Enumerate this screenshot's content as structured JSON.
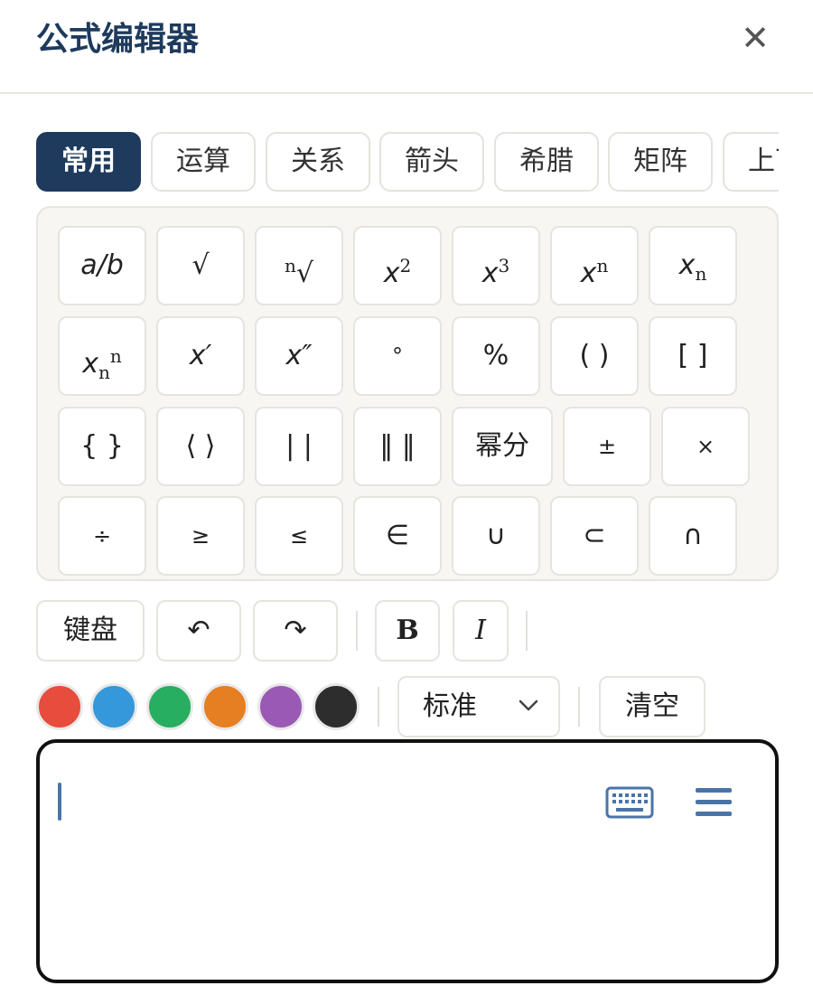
{
  "header": {
    "title": "公式编辑器",
    "close_glyph": "✕"
  },
  "tabs": [
    {
      "label": "常用",
      "active": true
    },
    {
      "label": "运算"
    },
    {
      "label": "关系"
    },
    {
      "label": "箭头"
    },
    {
      "label": "希腊"
    },
    {
      "label": "矩阵"
    },
    {
      "label": "上下"
    }
  ],
  "keys": {
    "fraction": "a/b",
    "sqrt": "√",
    "nroot_index": "n",
    "nroot_sign": "√",
    "sq_base": "x",
    "sq_exp": "2",
    "cube_base": "x",
    "cube_exp": "3",
    "pow_base": "x",
    "pow_exp": "n",
    "sub_base": "x",
    "sub_idx": "n",
    "subsup_base": "x",
    "subsup_sub": "n",
    "subsup_sup": "n",
    "prime": "x′",
    "dprime": "x″",
    "degree": "°",
    "percent": "%",
    "parens": "( )",
    "brackets": "[ ]",
    "braces": "{ }",
    "angles": "⟨ ⟩",
    "abs": "| |",
    "norm": "‖ ‖",
    "power_fraction": "幂分",
    "plusminus": "±",
    "times": "×",
    "divide": "÷",
    "geq": "≥",
    "leq": "≤",
    "in": "∈",
    "union": "∪",
    "subset": "⊂",
    "intersect": "∩"
  },
  "toolbar": {
    "keyboard": "键盘",
    "undo": "↶",
    "redo": "↷",
    "bold": "B",
    "italic": "I"
  },
  "colors": [
    "#e74c3c",
    "#3498db",
    "#27ae60",
    "#e67e22",
    "#9b59b6",
    "#2d2d2d"
  ],
  "size_select": {
    "value": "标准"
  },
  "clear": "清空",
  "icons": {
    "keyboard": "keyboard-icon",
    "menu": "menu-icon",
    "chevron": "chevron-down-icon"
  }
}
